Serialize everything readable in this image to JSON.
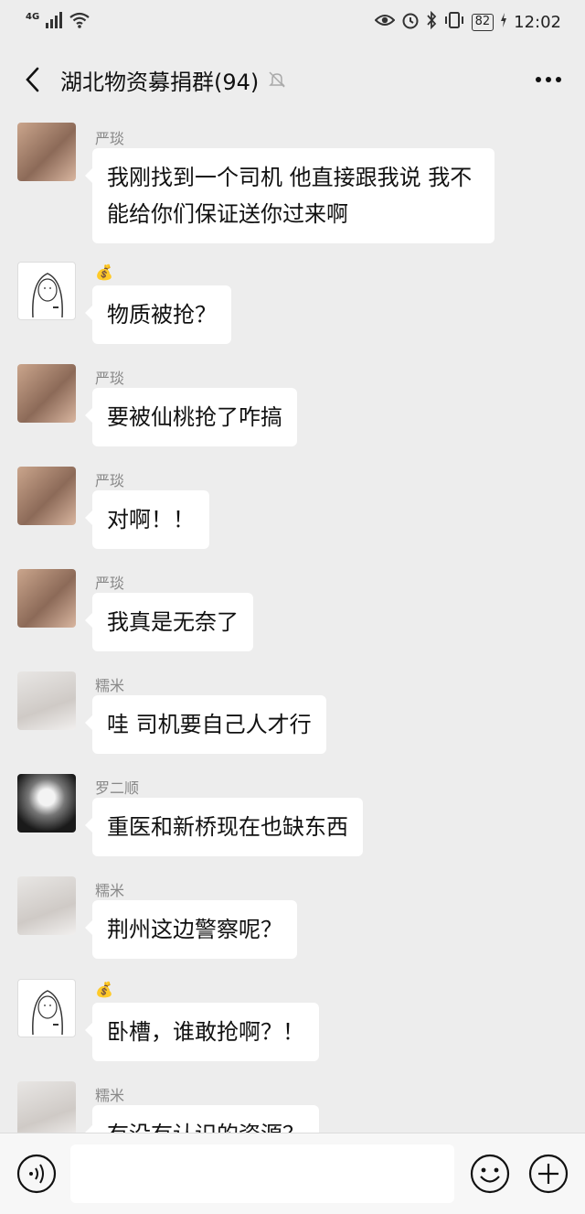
{
  "status_bar": {
    "network": "4G",
    "battery": "82",
    "time": "12:02"
  },
  "header": {
    "title": "湖北物资募捐群(94)"
  },
  "messages": [
    {
      "sender": "严琰",
      "text": "我刚找到一个司机 他直接跟我说 我不能给你们保证送你过来啊",
      "avatar": "girls"
    },
    {
      "sender": "💰",
      "text": "物质被抢？",
      "avatar": "sketch"
    },
    {
      "sender": "严琰",
      "text": "要被仙桃抢了咋搞",
      "avatar": "girls"
    },
    {
      "sender": "严琰",
      "text": "对啊！！",
      "avatar": "girls"
    },
    {
      "sender": "严琰",
      "text": "我真是无奈了",
      "avatar": "girls"
    },
    {
      "sender": "糯米",
      "text": "哇 司机要自己人才行",
      "avatar": "bed"
    },
    {
      "sender": "罗二顺",
      "text": "重医和新桥现在也缺东西",
      "avatar": "bw"
    },
    {
      "sender": "糯米",
      "text": "荆州这边警察呢？",
      "avatar": "bed"
    },
    {
      "sender": "💰",
      "text": "卧槽，谁敢抢啊？！",
      "avatar": "sketch"
    },
    {
      "sender": "糯米",
      "text": "有没有认识的资源？",
      "avatar": "bed"
    }
  ],
  "composer": {
    "value": "",
    "placeholder": ""
  },
  "colors": {
    "background": "#ededed",
    "bubble": "#ffffff",
    "sender_name": "#888888"
  },
  "icons": [
    "back-icon",
    "mute-bell-icon",
    "more-icon",
    "voice-icon",
    "emoji-icon",
    "plus-icon",
    "eye-icon",
    "alarm-icon",
    "bluetooth-icon",
    "vibrate-icon",
    "signal-icon",
    "wifi-icon"
  ]
}
